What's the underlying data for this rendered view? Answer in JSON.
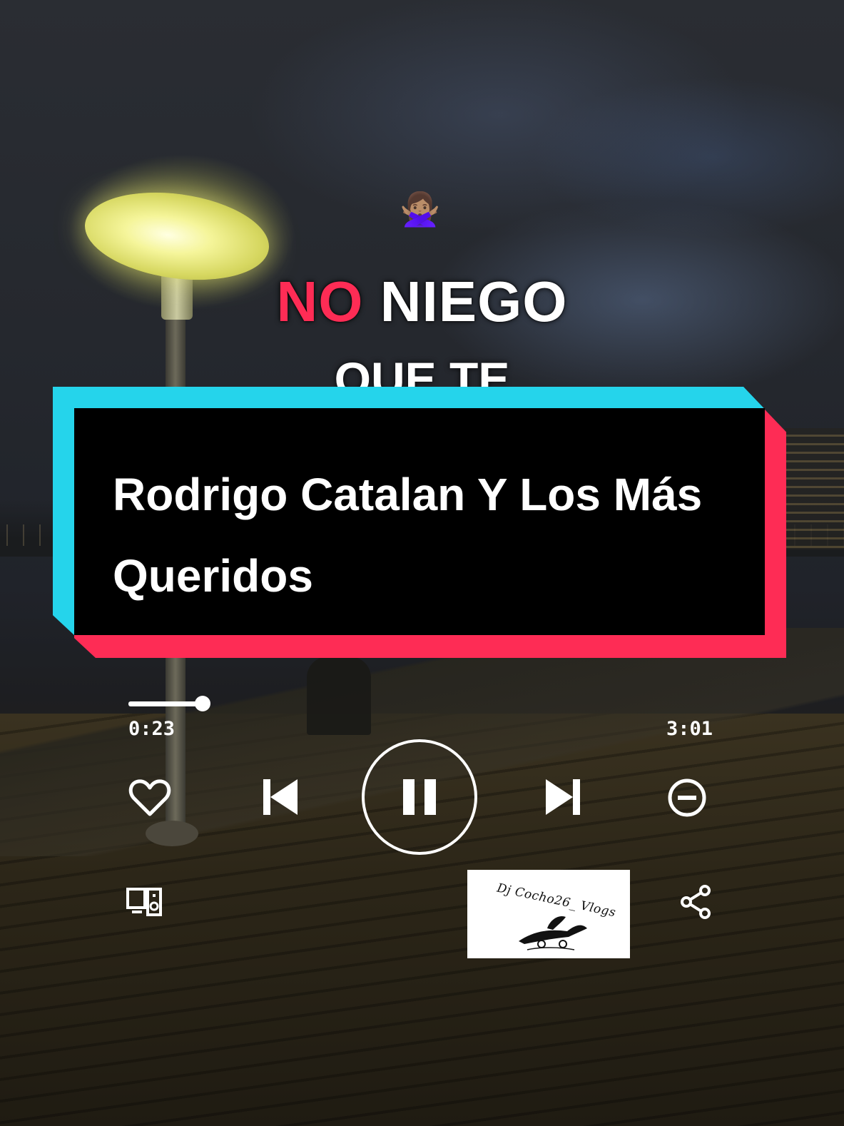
{
  "lyrics": {
    "emoji": "🙅🏽‍♀️",
    "line1_highlight": "NO",
    "line1_rest": "NIEGO",
    "line2": "QUE TE"
  },
  "title_card": {
    "title": "Rodrigo Catalan Y Los Más Queridos"
  },
  "player": {
    "elapsed": "0:23",
    "duration": "3:01",
    "progress_fraction": 0.127,
    "state": "playing"
  },
  "watermark": {
    "text": "Dj Cocho26_ Vlogs"
  },
  "colors": {
    "highlight_red": "#fe2c55",
    "accent_cyan": "#25d4eb",
    "card_black": "#000000"
  },
  "icons": {
    "like": "heart-icon",
    "previous": "skip-previous-icon",
    "play_pause": "pause-icon",
    "next": "skip-next-icon",
    "remove": "minus-circle-icon",
    "devices": "connect-devices-icon",
    "share": "share-icon"
  }
}
